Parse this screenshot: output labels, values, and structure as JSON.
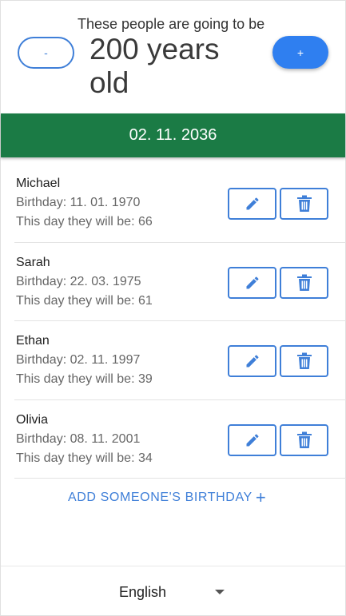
{
  "header": {
    "subtitle": "These people are going to be",
    "age_text": "200 years old",
    "minus_label": "-",
    "plus_label": "+"
  },
  "target_date": "02. 11. 2036",
  "people": [
    {
      "name": "Michael",
      "birthday": "Birthday: 11. 01. 1970",
      "age": "This day they will be: 66"
    },
    {
      "name": "Sarah",
      "birthday": "Birthday: 22. 03. 1975",
      "age": "This day they will be: 61"
    },
    {
      "name": "Ethan",
      "birthday": "Birthday: 02. 11. 1997",
      "age": "This day they will be: 39"
    },
    {
      "name": "Olivia",
      "birthday": "Birthday: 08. 11. 2001",
      "age": "This day they will be: 34"
    }
  ],
  "add_link": {
    "label": "ADD SOMEONE'S BIRTHDAY",
    "icon": "plus-icon"
  },
  "language": {
    "selected": "English"
  },
  "colors": {
    "accent": "#3f7fd8",
    "primary_button": "#2f7ff0",
    "date_bar": "#1b7b45"
  },
  "icons": {
    "edit": "pencil-icon",
    "delete": "trash-icon",
    "dropdown": "caret-down-icon"
  }
}
